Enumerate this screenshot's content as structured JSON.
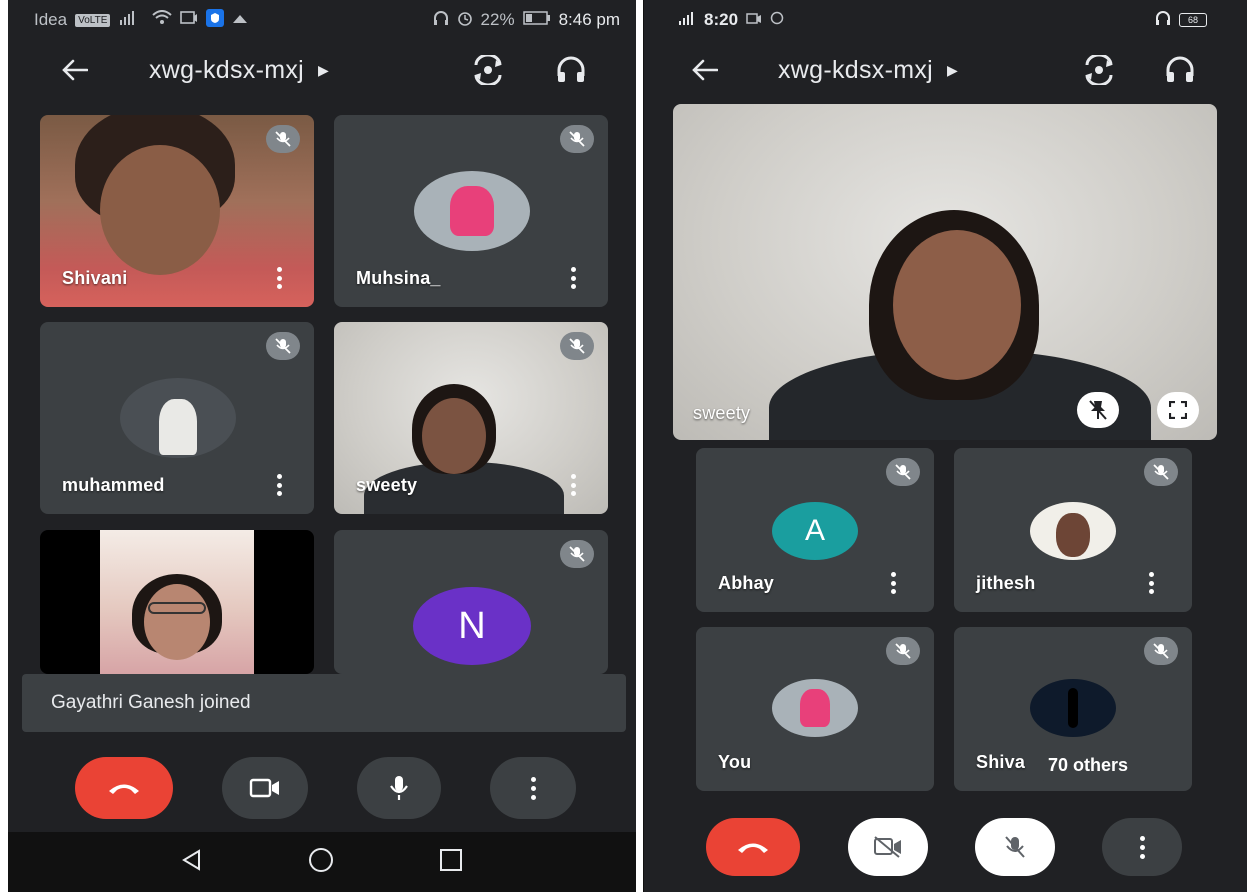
{
  "colors": {
    "app_background": "#202124",
    "tile_background": "#3c4043",
    "end_call": "#ea4335",
    "avatar_teal": "#1a9e9f",
    "avatar_purple": "#6a31c7",
    "mute_badge": "#80868b"
  },
  "left_phone": {
    "status_bar": {
      "carrier": "Idea",
      "volte_badge": "VoLTE",
      "battery": "22%",
      "time": "8:46 pm"
    },
    "meeting_code": "xwg-kdsx-mxj",
    "tiles": [
      {
        "name": "Shivani",
        "kind": "video",
        "muted": true
      },
      {
        "name": "Muhsina_",
        "kind": "avatar-photo",
        "muted": true
      },
      {
        "name": "muhammed",
        "kind": "avatar-photo",
        "muted": true
      },
      {
        "name": "sweety",
        "kind": "video",
        "muted": true
      },
      {
        "name": "",
        "kind": "video",
        "muted": false
      },
      {
        "name": "",
        "kind": "avatar-letter",
        "letter": "N",
        "muted": true
      }
    ],
    "toast": "Gayathri Ganesh joined",
    "controls": [
      "end-call",
      "camera",
      "microphone",
      "more"
    ],
    "nav": [
      "back",
      "home",
      "recents"
    ]
  },
  "right_phone": {
    "status_bar": {
      "time": "8:20",
      "battery": "68"
    },
    "meeting_code": "xwg-kdsx-mxj",
    "featured": {
      "name": "sweety"
    },
    "tiles": [
      {
        "name": "Abhay",
        "kind": "avatar-letter",
        "letter": "A",
        "muted": true
      },
      {
        "name": "jithesh",
        "kind": "avatar-photo",
        "muted": true
      },
      {
        "name": "You",
        "kind": "avatar-photo",
        "muted": true
      },
      {
        "name": "Shiva",
        "kind": "avatar-photo",
        "muted": true
      }
    ],
    "others_label": "70 others",
    "controls": [
      "end-call",
      "camera-off",
      "microphone-off",
      "more"
    ]
  }
}
